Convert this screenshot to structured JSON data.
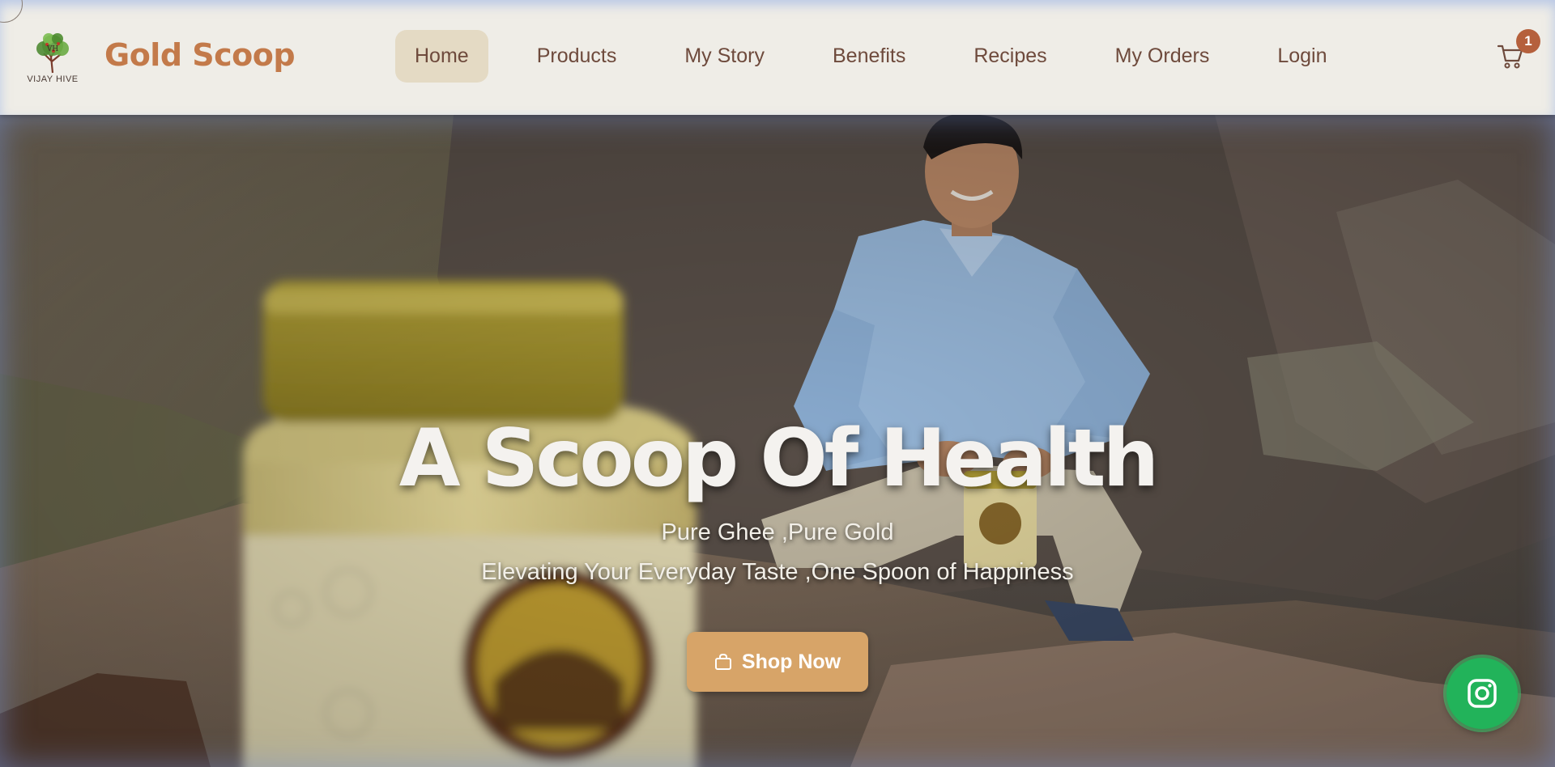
{
  "header": {
    "logo_text": "VIJAY HIVE",
    "brand": "Gold Scoop",
    "nav": [
      {
        "label": "Home",
        "active": true
      },
      {
        "label": "Products"
      },
      {
        "label": "My Story"
      },
      {
        "label": "Benefits"
      },
      {
        "label": "Recipes"
      },
      {
        "label": "My Orders"
      },
      {
        "label": "Login"
      }
    ],
    "cart_count": "1",
    "cart_icon": "shopping-cart-icon"
  },
  "hero": {
    "title": "A Scoop Of Health",
    "subtitle_1": "Pure Ghee ,Pure Gold",
    "subtitle_2": "Elevating Your Everyday Taste ,One Spoon of Happiness",
    "cta_label": "Shop Now",
    "cta_icon": "shopping-bag-icon"
  },
  "floating": {
    "icon": "instagram-icon"
  },
  "colors": {
    "brand": "#c37a4a",
    "nav_text": "#6e4a3c",
    "nav_active_bg": "#e4dac4",
    "header_bg": "#efede7",
    "cta_bg": "#d7a468",
    "badge_bg": "#b5603c",
    "floating_bg": "#22b35a"
  }
}
